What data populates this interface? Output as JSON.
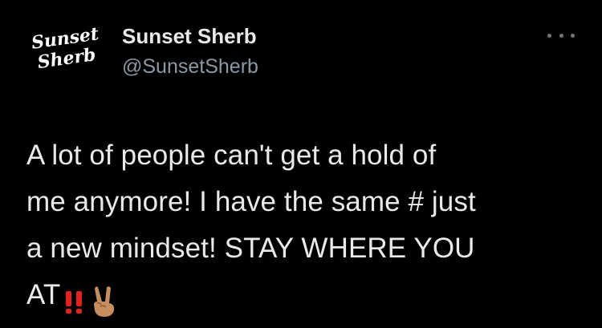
{
  "tweet": {
    "avatar_logo": "sunset-sherb-logo",
    "display_name": "Sunset Sherb",
    "handle": "@SunsetSherb",
    "more_icon": "more-horizontal-icon",
    "text_lines": [
      "A lot of people can't get a hold of",
      "me anymore! I have the same # just",
      "a new mindset! STAY WHERE YOU",
      "AT"
    ],
    "emojis": [
      "double-exclamation-icon",
      "victory-hand-icon"
    ]
  },
  "colors": {
    "background": "#000000",
    "primary_text": "#e7e9ea",
    "secondary_text": "#8b98a5",
    "icon_gray": "#71767b",
    "exclamation_red": "#e0211e",
    "skin_tone": "#c68e5e"
  }
}
